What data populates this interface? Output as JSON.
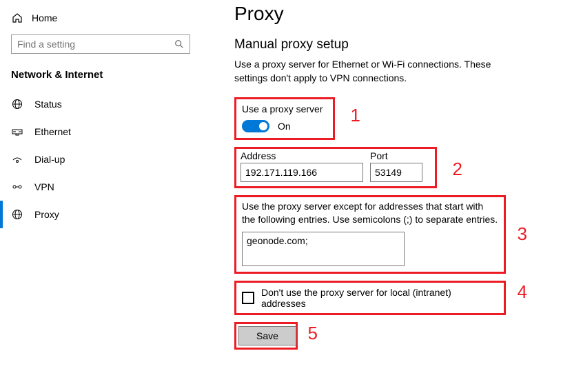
{
  "sidebar": {
    "home": "Home",
    "search_placeholder": "Find a setting",
    "category": "Network & Internet",
    "items": [
      {
        "label": "Status"
      },
      {
        "label": "Ethernet"
      },
      {
        "label": "Dial-up"
      },
      {
        "label": "VPN"
      },
      {
        "label": "Proxy"
      }
    ]
  },
  "page": {
    "title": "Proxy",
    "section_title": "Manual proxy setup",
    "section_desc": "Use a proxy server for Ethernet or Wi-Fi connections. These settings don't apply to VPN connections.",
    "toggle_label": "Use a proxy server",
    "toggle_state": "On",
    "address_label": "Address",
    "address_value": "192.171.119.166",
    "port_label": "Port",
    "port_value": "53149",
    "exceptions_text": "Use the proxy server except for addresses that start with the following entries. Use semicolons (;) to separate entries.",
    "exceptions_value": "geonode.com;",
    "local_label": "Don't use the proxy server for local (intranet) addresses",
    "save_label": "Save"
  },
  "annotations": {
    "n1": "1",
    "n2": "2",
    "n3": "3",
    "n4": "4",
    "n5": "5"
  }
}
